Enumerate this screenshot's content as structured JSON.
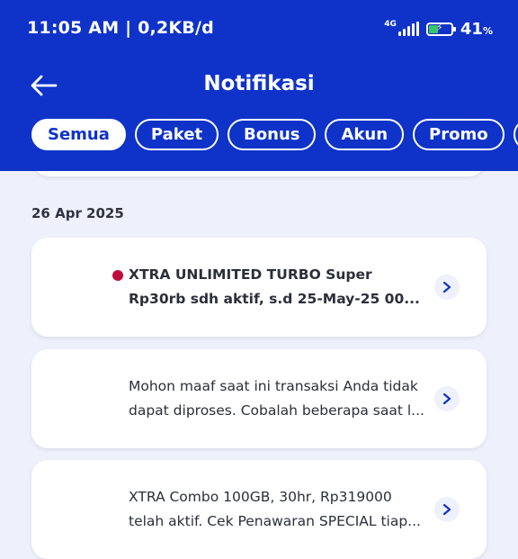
{
  "status_bar": {
    "time": "11:05 AM | 0,2KB/d",
    "network": "4G",
    "battery_percent": "41",
    "battery_unit": "%",
    "battery_level": 0.41
  },
  "header": {
    "title": "Notifikasi",
    "back_icon": "arrow-left-icon"
  },
  "tabs": [
    {
      "label": "Semua",
      "active": true
    },
    {
      "label": "Paket",
      "active": false
    },
    {
      "label": "Bonus",
      "active": false
    },
    {
      "label": "Akun",
      "active": false
    },
    {
      "label": "Promo",
      "active": false
    }
  ],
  "groups": [
    {
      "date": "26 Apr 2025",
      "items": [
        {
          "unread": true,
          "line1": "XTRA UNLIMITED TURBO Super",
          "line2": "Rp30rb sdh aktif,  s.d 25-May-25 00...",
          "icon": "chevron-right-icon"
        },
        {
          "unread": false,
          "line1": "Mohon maaf saat ini transaksi Anda tidak",
          "line2": "dapat diproses. Cobalah beberapa saat l...",
          "icon": "chevron-right-icon"
        },
        {
          "unread": false,
          "line1": "XTRA Combo 100GB, 30hr, Rp319000",
          "line2": "telah aktif. Cek Penawaran SPECIAL tiap...",
          "icon": "chevron-right-icon"
        }
      ]
    }
  ],
  "colors": {
    "brand_blue": "#0f33c8",
    "unread_dot": "#c00a3c",
    "background": "#eef0fb"
  }
}
